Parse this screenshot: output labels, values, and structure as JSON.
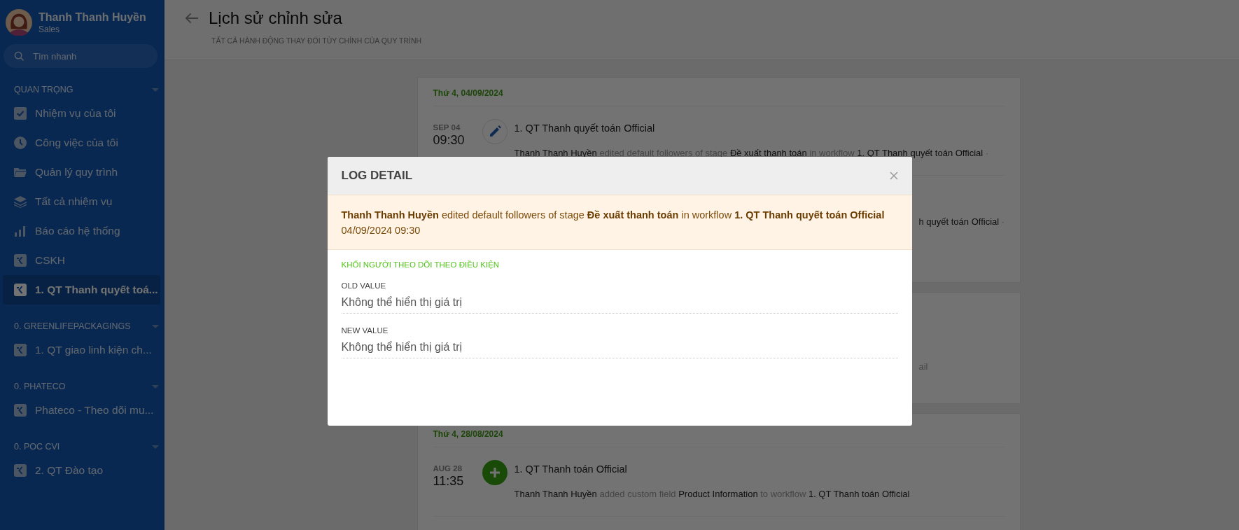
{
  "sidebar": {
    "user": {
      "name": "Thanh Thanh Huyền",
      "role": "Sales"
    },
    "search": {
      "placeholder": "Tìm nhanh"
    },
    "sections": [
      {
        "title": "QUAN TRỌNG",
        "expanded": true,
        "items": [
          {
            "label": "Nhiệm vụ của tôi",
            "kind": "tasks",
            "selected": false
          },
          {
            "label": "Công việc của tôi",
            "kind": "work",
            "selected": false
          },
          {
            "label": "Quản lý quy trình",
            "kind": "folders",
            "selected": false
          },
          {
            "label": "Tất cả nhiệm vụ",
            "kind": "stack",
            "selected": false
          },
          {
            "label": "Báo cáo hệ thống",
            "kind": "report",
            "selected": false
          },
          {
            "label": "CSKH",
            "kind": "workflow",
            "selected": false
          },
          {
            "label": "1. QT Thanh quyết toá...",
            "kind": "workflow",
            "selected": true
          }
        ]
      },
      {
        "title": "0. GREENLIFEPACKAGINGS",
        "expanded": true,
        "items": [
          {
            "label": "1. QT giao linh kiện ch...",
            "kind": "workflow",
            "selected": false
          }
        ]
      },
      {
        "title": "0. PHATECO",
        "expanded": true,
        "items": [
          {
            "label": "Phateco - Theo dõi mu...",
            "kind": "workflow",
            "selected": false
          }
        ]
      },
      {
        "title": "0. POC CVI",
        "expanded": true,
        "items": [
          {
            "label": "2. QT Đào tạo",
            "kind": "workflow",
            "selected": false
          }
        ]
      }
    ]
  },
  "page": {
    "title": "Lịch sử chỉnh sửa",
    "subtitle": "TẤT CẢ HÀNH ĐỘNG THAY ĐỔI TÙY CHỈNH CỦA QUY TRÌNH"
  },
  "timeline": [
    {
      "date": "Thứ 4, 04/09/2024",
      "entries": [
        {
          "kind": "edit",
          "month_day": "SEP 04",
          "time": "09:30",
          "title": "1. QT Thanh quyết toán Official",
          "description": [
            {
              "text": "Thanh Thanh Huyền",
              "kind": "subject"
            },
            {
              "text": "edited default followers of stage",
              "kind": "action"
            },
            {
              "text": "Đề xuất thanh toán",
              "kind": "subject"
            },
            {
              "text": "in workflow",
              "kind": "action"
            },
            {
              "text": "1. QT Thanh quyết toán Official",
              "kind": "subject"
            },
            {
              "text": "·",
              "kind": "action"
            }
          ]
        },
        {
          "kind": "partial",
          "description": [
            {
              "text": "h quyết toán Official",
              "kind": "subject"
            },
            {
              "text": "·",
              "kind": "action"
            }
          ]
        }
      ]
    },
    {
      "entries": [
        {
          "kind": "partial",
          "description": [
            {
              "text": "ail",
              "kind": "action"
            }
          ]
        }
      ]
    },
    {
      "date": "Thứ 4, 28/08/2024",
      "entries": [
        {
          "kind": "add",
          "month_day": "AUG 28",
          "time": "11:35",
          "title": "1. QT Thanh toán Official",
          "description": [
            {
              "text": "Thanh Thanh Huyền",
              "kind": "subject"
            },
            {
              "text": "added custom field",
              "kind": "action"
            },
            {
              "text": "Product Information",
              "kind": "subject"
            },
            {
              "text": "to workflow",
              "kind": "action"
            },
            {
              "text": "1. QT Thanh toán Official",
              "kind": "subject"
            }
          ]
        }
      ]
    }
  ],
  "modal": {
    "title": "LOG DETAIL",
    "summary": "**Thanh Thanh Huyền** edited default followers of stage **Đề xuất thanh toán** in workflow **1. QT Thanh quyết toán Official** 04/09/2024 09:30",
    "section": "KHỐI NGƯỜI THEO DÕI THEO ĐIỀU KIỆN",
    "fields": [
      {
        "label": "OLD VALUE",
        "value": "Không thể hiển thị giá trị"
      },
      {
        "label": "NEW VALUE",
        "value": "Không thể hiển thị giá trị"
      }
    ]
  }
}
